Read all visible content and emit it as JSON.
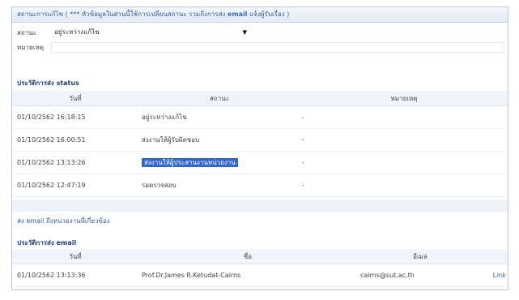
{
  "panel_title": "สถานะการแก้ไข ( *** หัวข้อมูลในส่วนนี้ใช้การเปลี่ยนสถานะ รวมถึงการส่ง email แจ้งผู้รับเรื่อง )",
  "panel_title_highlight": "email",
  "form": {
    "status_label": "สถานะ",
    "status_value": "อยู่ระหว่างแก้ไข",
    "note_label": "หมายเหตุ",
    "note_value": ""
  },
  "status_history": {
    "title": "ประวัติการส่ง status",
    "columns": [
      "วันที่",
      "สถานะ",
      "หมายเหตุ"
    ],
    "rows": [
      {
        "date": "01/10/2562 16:18:15",
        "status": "อยู่ระหว่างแก้ไข",
        "note": "-"
      },
      {
        "date": "01/10/2562 16:00:51",
        "status": "ส่งงานให้ผู้รับผิดชอบ",
        "note": "-"
      },
      {
        "date": "01/10/2562 13:13:26",
        "status": "ส่งงานให้ผู้ประสานงานหน่วยงาน",
        "note": "-"
      },
      {
        "date": "01/10/2562 12:47:19",
        "status": "รอตรวจสอบ",
        "note": "-"
      }
    ]
  },
  "email_section": {
    "heading": "ส่ง email ถึงหน่วยงานที่เกี่ยวข้อง",
    "history_title": "ประวัติการส่ง email",
    "columns": [
      "วันที่",
      "ชื่อ",
      "อีเมล"
    ],
    "rows": [
      {
        "date": "01/10/2562 13:13:36",
        "name": "Prof.Dr.James R.Ketudat-Cairns",
        "email": "cairns@sut.ac.th",
        "action": "Link"
      }
    ]
  }
}
